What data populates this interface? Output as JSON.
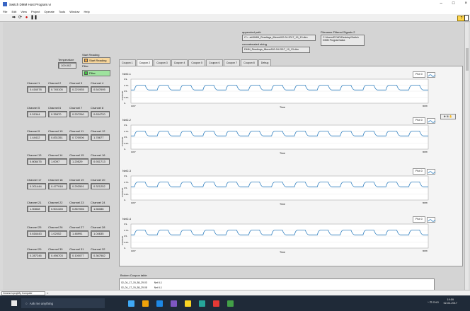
{
  "window": {
    "title": "Switch DMM Host Program.vi",
    "controls": {
      "minimize": "–",
      "maximize": "□",
      "close": "×"
    }
  },
  "menu": [
    "File",
    "Edit",
    "View",
    "Project",
    "Operate",
    "Tools",
    "Window",
    "Help"
  ],
  "toolbar": {
    "icons": [
      "run-arrow-icon",
      "run-continuous-icon",
      "abort-icon",
      "pause-icon"
    ]
  },
  "temperature": {
    "label": "Temperature",
    "value": "100.002"
  },
  "start_reading": {
    "label": "Start Reading",
    "button": "Start Reading"
  },
  "filter": {
    "label": "Filter",
    "button": "Filter"
  },
  "appended_path": {
    "label": "appended path",
    "value": "C:\\...ab\\DMM_Readings_filtered\\02-04-2017_19_13.dtm"
  },
  "concatenated_string": {
    "label": "concatenated string",
    "value": "DMM_Readings_filtered\\02-04-2017_19_13.dtm"
  },
  "filename_filtered": {
    "label": "Filename Filtered Signals 2",
    "value": "C:\\Users\\ECAD\\Desktop\\Switch DMM Program\\data"
  },
  "channels": [
    {
      "label": "Channel 1",
      "value": "0.416078"
    },
    {
      "label": "Channel 2",
      "value": "0.745105"
    },
    {
      "label": "Channel 3",
      "value": "0.221935"
    },
    {
      "label": "Channel 4",
      "value": "0.547695"
    },
    {
      "label": "Channel 5",
      "value": "0.51344"
    },
    {
      "label": "Channel 6",
      "value": "0.35870"
    },
    {
      "label": "Channel 7",
      "value": "0.207260"
    },
    {
      "label": "Channel 8",
      "value": "0.634720"
    },
    {
      "label": "Channel 9",
      "value": "1.44412"
    },
    {
      "label": "Channel 10",
      "value": "0.831351"
    },
    {
      "label": "Channel 11",
      "value": "0.720006"
    },
    {
      "label": "Channel 12",
      "value": "1.78677"
    },
    {
      "label": "Channel 13",
      "value": "0.806475"
    },
    {
      "label": "Channel 14",
      "value": "1.0097"
    },
    {
      "label": "Channel 15",
      "value": "1.20529"
    },
    {
      "label": "Channel 16",
      "value": "0.931713"
    },
    {
      "label": "Channel 17",
      "value": "0.201444"
    },
    {
      "label": "Channel 18",
      "value": "0.477918"
    },
    {
      "label": "Channel 19",
      "value": "0.292591"
    },
    {
      "label": "Channel 20",
      "value": "0.321252"
    },
    {
      "label": "Channel 21",
      "value": "1.50848"
    },
    {
      "label": "Channel 22",
      "value": "0.501328"
    },
    {
      "label": "Channel 23",
      "value": "0.857056"
    },
    {
      "label": "Channel 24",
      "value": "1.56086"
    },
    {
      "label": "Channel 25",
      "value": "0.616443"
    },
    {
      "label": "Channel 26",
      "value": "1.02052"
    },
    {
      "label": "Channel 27",
      "value": "1.48991"
    },
    {
      "label": "Channel 28",
      "value": "1.04635"
    },
    {
      "label": "Channel 29",
      "value": "0.287246"
    },
    {
      "label": "Channel 30",
      "value": "0.496703"
    },
    {
      "label": "Channel 31",
      "value": "0.100077"
    },
    {
      "label": "Channel 32",
      "value": "0.367582"
    }
  ],
  "tabs": [
    "Coupon 1",
    "Coupon 2",
    "Coupon 3",
    "Coupon 4",
    "Coupon 5",
    "Coupon 6",
    "Coupon 7",
    "Coupon 8",
    "Debug"
  ],
  "active_tab": "Coupon 2",
  "plots": [
    {
      "name": "Net2-1",
      "legend": "Plot 0"
    },
    {
      "name": "Net2-2",
      "legend": "Plot 0"
    },
    {
      "name": "Net2-3",
      "legend": "Plot 0"
    },
    {
      "name": "Net2-4",
      "legend": "Plot 0"
    }
  ],
  "plot_axes": {
    "xlabel": "Time",
    "ylabel": "Amplitude",
    "xmin": "1067",
    "xmax": "8058",
    "yticks": [
      "0.9-",
      "0.75-",
      "0.5-",
      "0.25-",
      "0-"
    ]
  },
  "palette_label": "✥ ⊞ ✋",
  "coupon_table": {
    "title": "Broken Coupon table",
    "rows": [
      {
        "time": "02_04_17_19_58_29.03",
        "net": "Net 6-1"
      },
      {
        "time": "02_04_17_19_58_29.08",
        "net": "Net 6-1"
      }
    ]
  },
  "status_project": "Volume.lvproj/My Computer",
  "status_arrow": "<",
  "taskbar": {
    "search_placeholder": "Ask me anything",
    "system": "^ ⊡ ENG",
    "time": "19:59",
    "date": "02-04-2017",
    "lang": "INTL",
    "colors": [
      "#3fa9f5",
      "#f0a30a",
      "#1e88e5",
      "#7e57c2",
      "#f9d423",
      "#26a69a",
      "#e53935",
      "#43a047"
    ]
  },
  "colors": {
    "waveform": "#2f7fbf",
    "led_orange": "#f2a23c",
    "led_green": "#3ec63e",
    "start_bg": "#f7d69c",
    "filter_bg": "#9ee39e"
  }
}
